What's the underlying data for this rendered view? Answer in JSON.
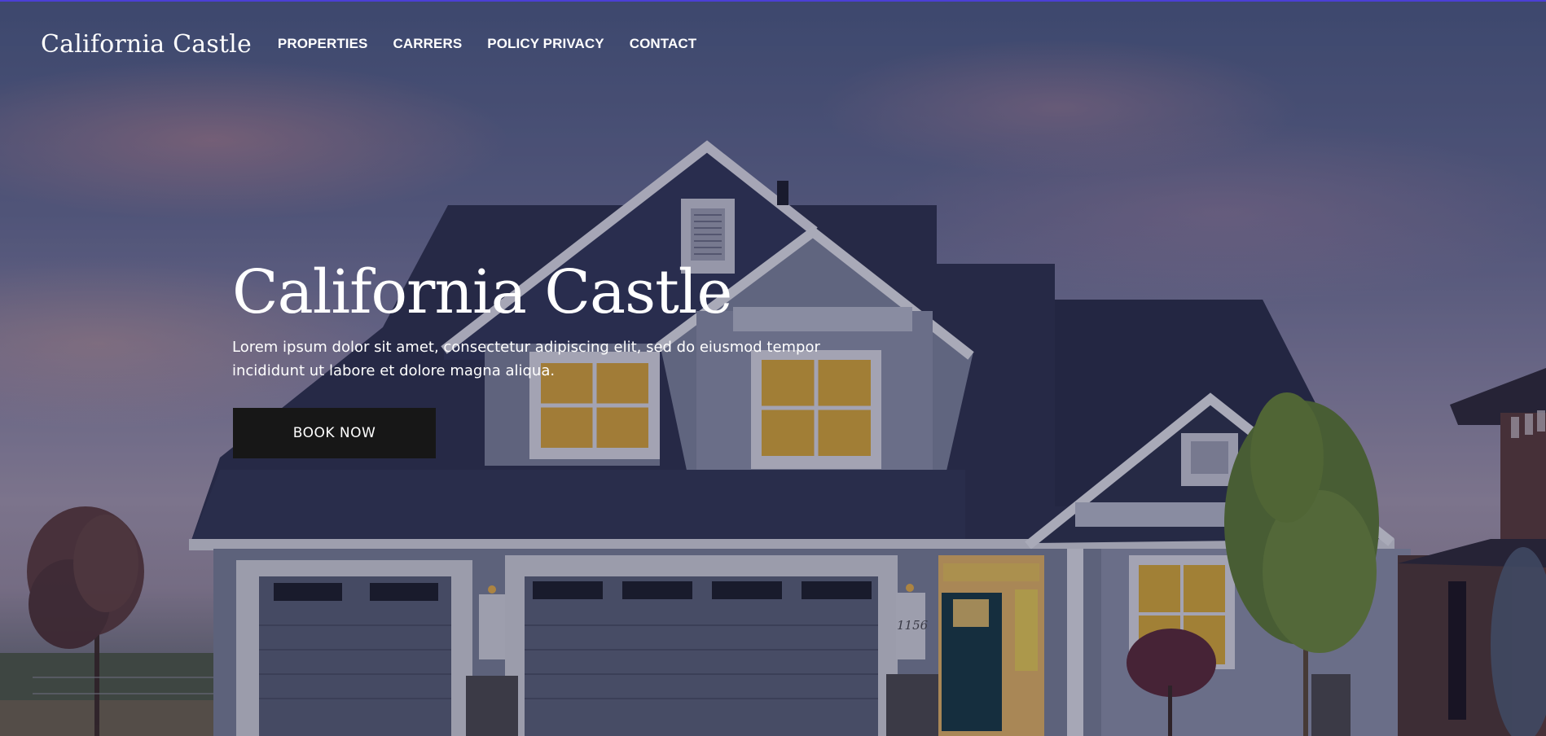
{
  "brand": {
    "logo_text": "California Castle"
  },
  "nav": {
    "items": [
      {
        "label": "PROPERTIES"
      },
      {
        "label": "CARRERS"
      },
      {
        "label": "POLICY PRIVACY"
      },
      {
        "label": "CONTACT"
      }
    ]
  },
  "hero": {
    "title": "California Castle",
    "text": "Lorem ipsum dolor sit amet, consectetur adipiscing elit, sed do eiusmod tempor incididunt ut labore et dolore magna aliqua.",
    "cta_label": "BOOK NOW",
    "house_number": "1156"
  },
  "colors": {
    "accent_line": "#4b3fd6",
    "button_bg": "#171717",
    "text": "#ffffff"
  }
}
